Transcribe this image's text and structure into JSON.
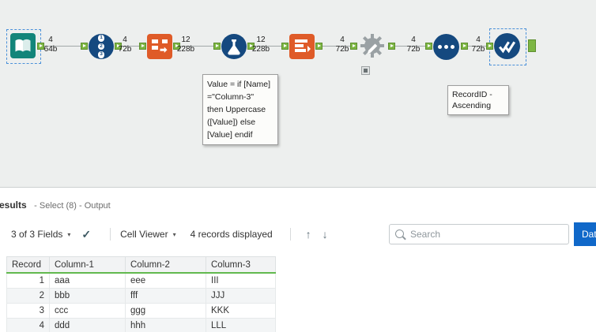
{
  "canvas": {
    "connections": [
      {
        "count": "4",
        "size": "64b"
      },
      {
        "count": "4",
        "size": "72b"
      },
      {
        "count": "12",
        "size": "228b"
      },
      {
        "count": "12",
        "size": "228b"
      },
      {
        "count": "4",
        "size": "72b"
      },
      {
        "count": "4",
        "size": "72b"
      },
      {
        "count": "4",
        "size": "72b"
      }
    ],
    "recordid_digits": [
      "1",
      "2",
      "3"
    ],
    "formula_annotation": "Value = if [Name]\n=\"Column-3\"\nthen Uppercase\n([Value]) else\n[Value] endif",
    "sort_annotation": "RecordID -\nAscending"
  },
  "results": {
    "title": "esults",
    "subtitle": "- Select (8) - Output",
    "toolbar": {
      "fields_label": "3 of 3 Fields",
      "cell_viewer_label": "Cell Viewer",
      "records_label": "4 records displayed",
      "up_arrow": "↑",
      "down_arrow": "↓",
      "search_placeholder": "Search",
      "data_button_label": "Dat"
    },
    "table": {
      "headers": [
        "Record",
        "Column-1",
        "Column-2",
        "Column-3"
      ],
      "rows": [
        [
          "1",
          "aaa",
          "eee",
          "III"
        ],
        [
          "2",
          "bbb",
          "fff",
          "JJJ"
        ],
        [
          "3",
          "ccc",
          "ggg",
          "KKK"
        ],
        [
          "4",
          "ddd",
          "hhh",
          "LLL"
        ]
      ]
    }
  }
}
